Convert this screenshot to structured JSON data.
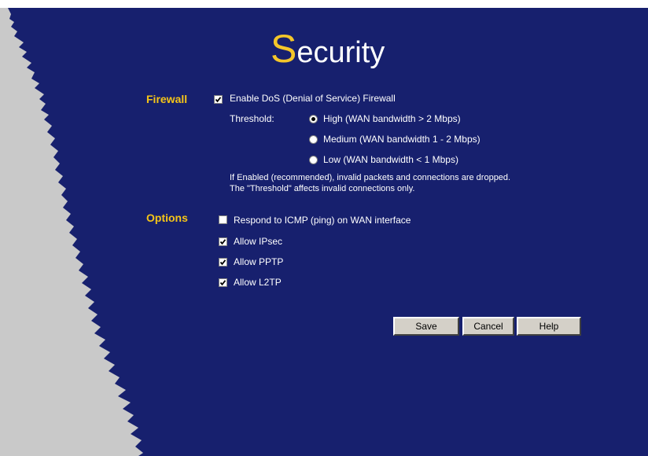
{
  "colors": {
    "background": "#17206e",
    "accent": "#f4c62a",
    "sidebar": "#c9c9c9",
    "text": "#ffffff"
  },
  "header": {
    "title_initial": "S",
    "title_rest": "ecurity"
  },
  "firewall": {
    "section_label": "Firewall",
    "enable_dos": {
      "label": "Enable DoS (Denial of Service) Firewall",
      "checked": true
    },
    "threshold_label": "Threshold:",
    "options": [
      {
        "label": "High (WAN bandwidth > 2 Mbps)",
        "selected": true
      },
      {
        "label": "Medium (WAN bandwidth 1 - 2 Mbps)",
        "selected": false
      },
      {
        "label": "Low (WAN bandwidth < 1 Mbps)",
        "selected": false
      }
    ],
    "note_line1": "If Enabled (recommended), invalid packets and connections are dropped.",
    "note_line2": "The \"Threshold\" affects invalid connections only."
  },
  "options": {
    "section_label": "Options",
    "items": [
      {
        "label": "Respond to ICMP (ping) on WAN interface",
        "checked": false
      },
      {
        "label": "Allow IPsec",
        "checked": true
      },
      {
        "label": "Allow PPTP",
        "checked": true
      },
      {
        "label": "Allow L2TP",
        "checked": true
      }
    ]
  },
  "buttons": {
    "save": "Save",
    "cancel": "Cancel",
    "help": "Help"
  }
}
